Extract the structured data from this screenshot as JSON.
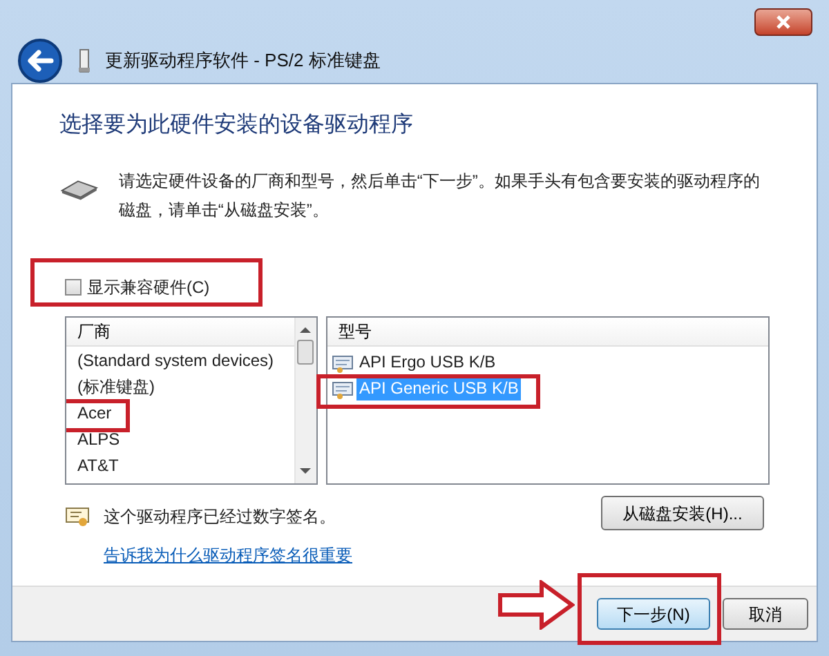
{
  "window": {
    "title": "更新驱动程序软件 - PS/2 标准键盘"
  },
  "heading": "选择要为此硬件安装的设备驱动程序",
  "instructions": "请选定硬件设备的厂商和型号，然后单击“下一步”。如果手头有包含要安装的驱动程序的磁盘，请单击“从磁盘安装”。",
  "show_compatible": {
    "label": "显示兼容硬件(C)",
    "checked": false
  },
  "manufacturers": {
    "header": "厂商",
    "items": [
      {
        "label": "(Standard system devices)",
        "selected": false
      },
      {
        "label": "(标准键盘)",
        "selected": false
      },
      {
        "label": "Acer",
        "selected": false
      },
      {
        "label": "ALPS",
        "selected": false
      },
      {
        "label": "AT&T",
        "selected": false
      }
    ]
  },
  "models": {
    "header": "型号",
    "items": [
      {
        "label": "API Ergo USB K/B",
        "selected": false
      },
      {
        "label": "API Generic USB K/B",
        "selected": true
      }
    ]
  },
  "signature_note": "这个驱动程序已经过数字签名。",
  "signature_link": "告诉我为什么驱动程序签名很重要",
  "have_disk_button": "从磁盘安装(H)...",
  "buttons": [
    {
      "label": "下一步(N)",
      "kind": "default"
    },
    {
      "label": "取消",
      "kind": "normal"
    }
  ]
}
